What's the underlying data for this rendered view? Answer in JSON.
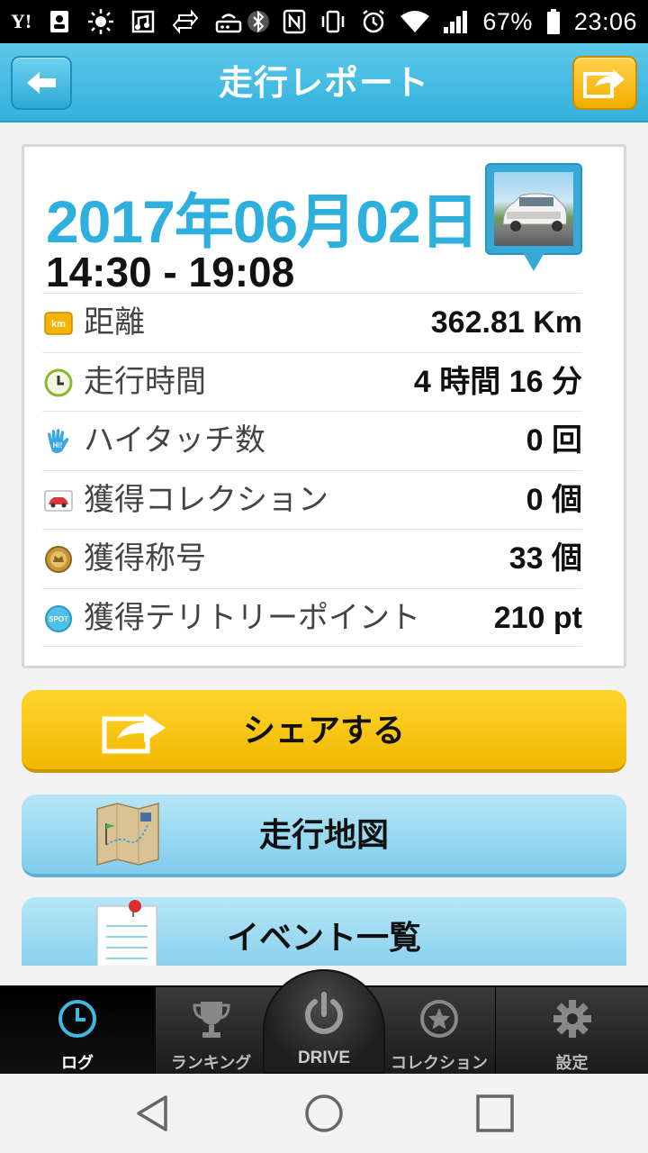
{
  "status_bar": {
    "battery": "67%",
    "time": "23:06",
    "left_icons": [
      "yahoo-icon",
      "contact-card-icon",
      "weather-sun-icon",
      "media-icon",
      "sync-icon",
      "router-icon"
    ],
    "right_icons": [
      "bluetooth-icon",
      "nfc-icon",
      "vibrate-icon",
      "alarm-icon",
      "wifi-icon",
      "signal-icon",
      "battery-icon"
    ]
  },
  "header": {
    "title": "走行レポート",
    "back_icon": "arrow-left-icon",
    "share_icon": "share-icon"
  },
  "report": {
    "date": "2017年06月02日",
    "time_range": "14:30 - 19:08",
    "rows": [
      {
        "icon": "km-icon",
        "label": "距離",
        "value": "362.81 Km"
      },
      {
        "icon": "clock-icon",
        "label": "走行時間",
        "value": "4 時間 16 分"
      },
      {
        "icon": "hi-five-icon",
        "label": "ハイタッチ数",
        "value": "0 回"
      },
      {
        "icon": "car-card-icon",
        "label": "獲得コレクション",
        "value": "0 個"
      },
      {
        "icon": "title-badge-icon",
        "label": "獲得称号",
        "value": "33 個"
      },
      {
        "icon": "spot-icon",
        "label": "獲得テリトリーポイント",
        "value": "210 pt"
      }
    ]
  },
  "actions": {
    "share": "シェアする",
    "map": "走行地図",
    "events": "イベント一覧"
  },
  "tabbar": {
    "log": "ログ",
    "ranking": "ランキング",
    "drive": "DRIVE",
    "collection": "コレクション",
    "settings": "設定"
  },
  "icon_labels": {
    "km": "km",
    "hi": "Hi!",
    "spot": "SPOT"
  },
  "colors": {
    "accent": "#2db0dd",
    "share_yellow": "#f6c200",
    "header_blue": "#3fb8e2"
  }
}
